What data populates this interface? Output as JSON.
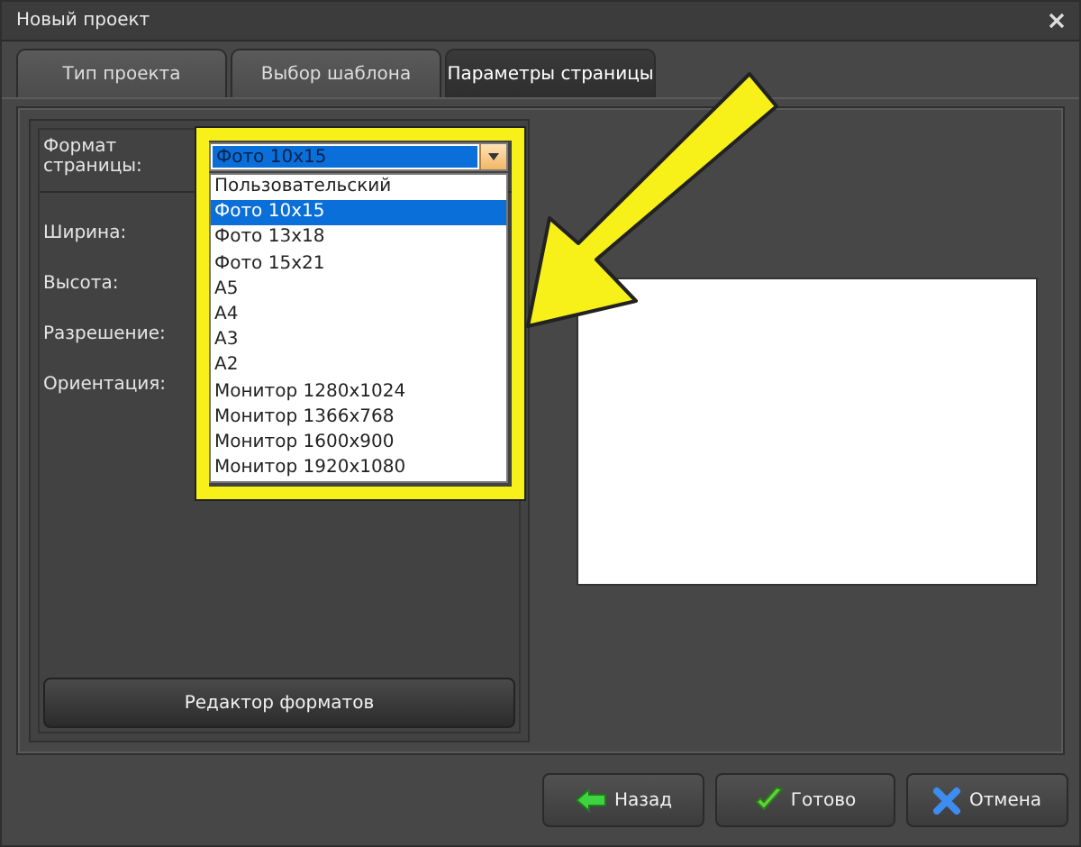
{
  "window": {
    "title": "Новый проект"
  },
  "tabs": [
    {
      "label": "Тип проекта",
      "selected": false
    },
    {
      "label": "Выбор шаблона",
      "selected": false
    },
    {
      "label": "Параметры страницы",
      "selected": true
    }
  ],
  "page_format": {
    "label": "Формат страницы:",
    "value": "Фото 10x15",
    "expanded": true,
    "options": [
      {
        "label": "Пользовательский",
        "selected": false
      },
      {
        "label": "Фото 10x15",
        "selected": true
      },
      {
        "label": "Фото 13x18",
        "selected": false
      },
      {
        "label": "Фото 15x21",
        "selected": false
      },
      {
        "label": "A5",
        "selected": false
      },
      {
        "label": "A4",
        "selected": false
      },
      {
        "label": "A3",
        "selected": false
      },
      {
        "label": "A2",
        "selected": false
      },
      {
        "label": "Монитор 1280x1024",
        "selected": false
      },
      {
        "label": "Монитор 1366x768",
        "selected": false
      },
      {
        "label": "Монитор 1600x900",
        "selected": false
      },
      {
        "label": "Монитор 1920x1080",
        "selected": false
      }
    ]
  },
  "fields": [
    {
      "label": "Ширина:"
    },
    {
      "label": "Высота:"
    },
    {
      "label": "Разрешение:"
    },
    {
      "label": "Ориентация:"
    }
  ],
  "format_editor_button": "Редактор форматов",
  "buttons": [
    {
      "label": "Назад",
      "kind": "back"
    },
    {
      "label": "Готово",
      "kind": "done"
    },
    {
      "label": "Отмена",
      "kind": "cancel"
    }
  ]
}
